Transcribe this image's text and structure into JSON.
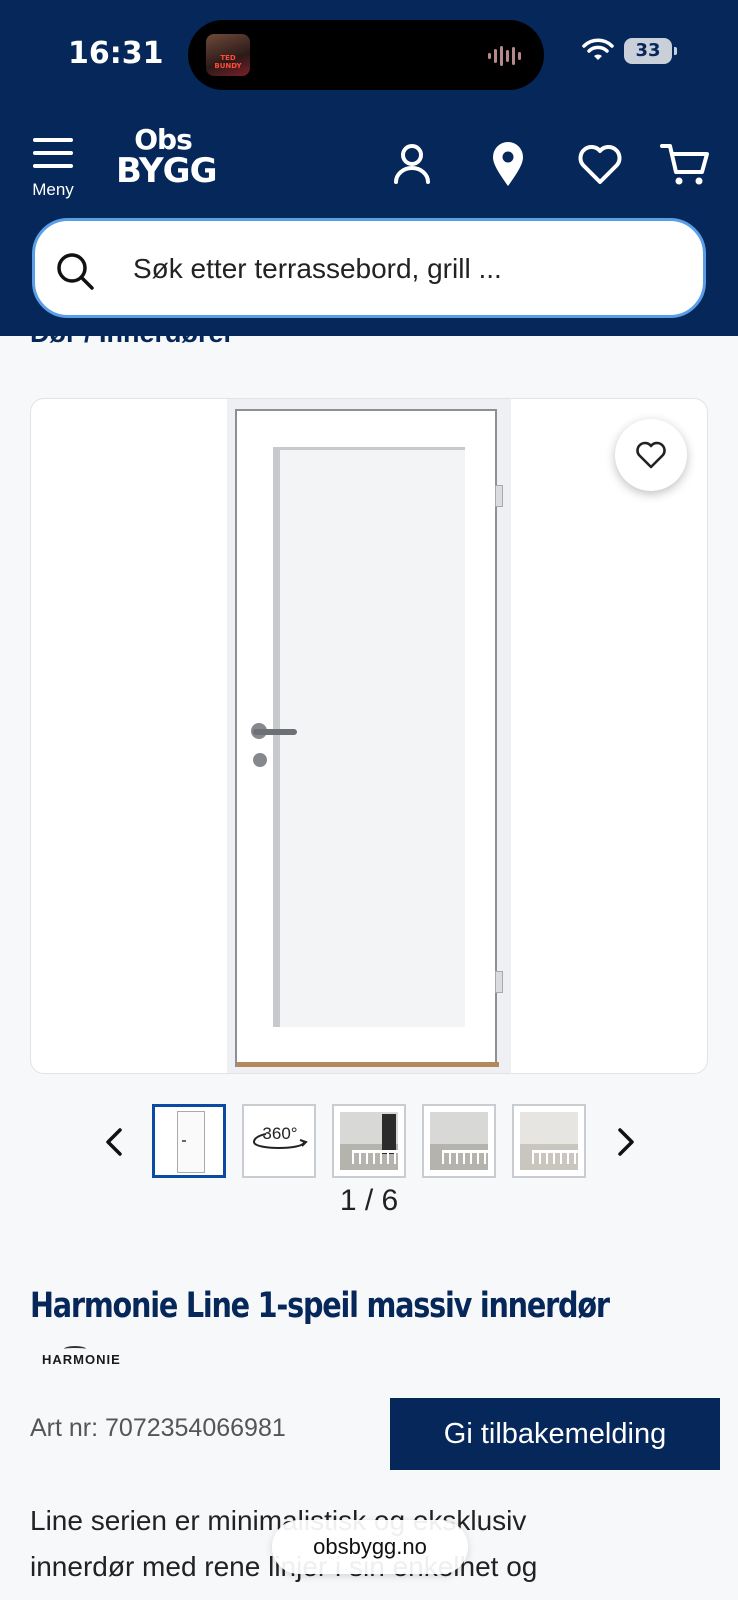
{
  "status_bar": {
    "time": "16:31",
    "now_playing_label": "TED BUNDY",
    "battery": "33"
  },
  "header": {
    "menu_label": "Meny",
    "logo_line1": "Obs",
    "logo_line2": "BYGG",
    "icons": [
      "account-icon",
      "store-location-icon",
      "favorites-icon",
      "cart-icon"
    ]
  },
  "search": {
    "placeholder": "Søk etter terrassebord, grill ..."
  },
  "breadcrumb": "Dør / Innerdører",
  "gallery": {
    "counter": "1 / 6",
    "thumbnails": [
      "door-front",
      "360-view",
      "room-1",
      "room-2",
      "room-3"
    ],
    "thumb_360_label": "360°"
  },
  "product": {
    "title": "Harmonie Line 1-speil massiv innerdør",
    "brand": "HARMONIE",
    "art_nr": "Art nr: 7072354066981",
    "description_lines": [
      "Line serien er minimalistisk og eksklusiv",
      "innerdør med rene linjer i sin enkelhet og"
    ]
  },
  "feedback_button": "Gi tilbakemelding",
  "browser": {
    "url": "obsbygg.no"
  },
  "colors": {
    "brand_navy": "#062759",
    "search_border": "#5b9ee8",
    "active_thumb": "#0b4aa2"
  }
}
